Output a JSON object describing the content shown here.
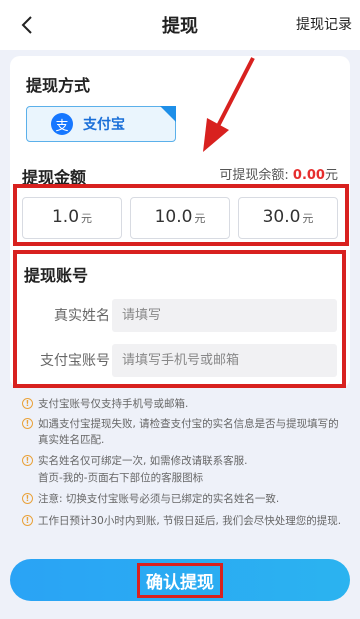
{
  "header": {
    "title": "提现",
    "records_label": "提现记录",
    "back_icon": "chevron-left-icon"
  },
  "method_section": {
    "title": "提现方式",
    "option_label": "支付宝",
    "option_logo_glyph": "支",
    "option_selected": true
  },
  "amount_section": {
    "title": "提现金额",
    "balance_label": "可提现余额:",
    "balance_value": "0.00",
    "balance_unit": "元",
    "options": [
      {
        "value": "1.0",
        "unit": "元"
      },
      {
        "value": "10.0",
        "unit": "元"
      },
      {
        "value": "30.0",
        "unit": "元"
      }
    ]
  },
  "account_section": {
    "title": "提现账号",
    "name_label": "真实姓名",
    "name_placeholder": "请填写",
    "account_label": "支付宝账号",
    "account_placeholder": "请填写手机号或邮箱"
  },
  "notes": [
    "支付宝账号仅支持手机号或邮箱.",
    "如遇支付宝提现失败, 请检查支付宝的实名信息是否与提现填写的真实姓名匹配.",
    "实名姓名仅可绑定一次, 如需修改请联系客服.",
    "首页-我的-页面右下部位的客服图标",
    "注意: 切换支付宝账号必须与已绑定的实名姓名一致.",
    "工作日预计30小时内到账, 节假日延后, 我们会尽快处理您的提现."
  ],
  "confirm_label": "确认提现",
  "colors": {
    "accent": "#2aa3f5",
    "highlight_red": "#d8211f",
    "balance_red": "#e62e2e"
  }
}
